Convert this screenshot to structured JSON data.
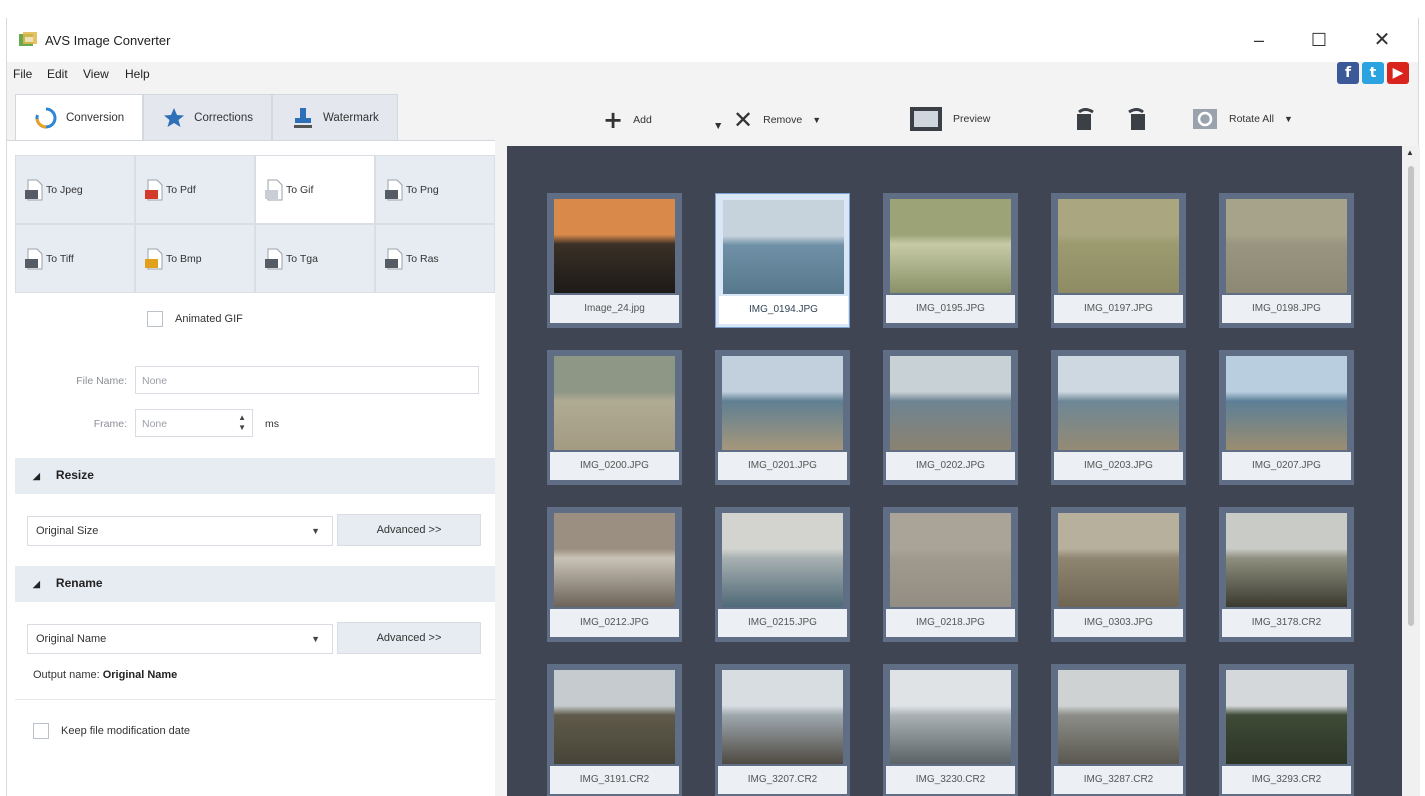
{
  "window": {
    "title": "AVS Image Converter"
  },
  "menu": [
    "File",
    "Edit",
    "View",
    "Help"
  ],
  "social": [
    {
      "icon": "facebook-icon",
      "glyph": "f",
      "color": "#3b5998"
    },
    {
      "icon": "twitter-icon",
      "glyph": "t",
      "color": "#2aa3e0"
    },
    {
      "icon": "youtube-icon",
      "glyph": "▶",
      "color": "#d9231d"
    }
  ],
  "tabs": [
    {
      "label": "Conversion",
      "icon": "conversion-icon",
      "active": true
    },
    {
      "label": "Corrections",
      "icon": "star-icon",
      "active": false
    },
    {
      "label": "Watermark",
      "icon": "stamp-icon",
      "active": false
    }
  ],
  "formats": [
    {
      "label": "To Jpeg",
      "icon": "jpeg-icon",
      "color": "#555c66"
    },
    {
      "label": "To Pdf",
      "icon": "pdf-icon",
      "color": "#d33a2b"
    },
    {
      "label": "To Gif",
      "icon": "gif-icon",
      "color": "#c9ced6",
      "active": true
    },
    {
      "label": "To Png",
      "icon": "png-icon",
      "color": "#555c66"
    },
    {
      "label": "To Tiff",
      "icon": "tiff-icon",
      "color": "#555c66"
    },
    {
      "label": "To Bmp",
      "icon": "bmp-icon",
      "color": "#e0a21c"
    },
    {
      "label": "To Tga",
      "icon": "tga-icon",
      "color": "#555c66"
    },
    {
      "label": "To Ras",
      "icon": "ras-icon",
      "color": "#555c66"
    }
  ],
  "options": {
    "animated_gif": "Animated GIF",
    "file_name_label": "File Name:",
    "file_name_value": "None",
    "frame_label": "Frame:",
    "frame_value": "None",
    "frame_unit": "ms"
  },
  "resize": {
    "title": "Resize",
    "value": "Original Size",
    "advanced": "Advanced >>"
  },
  "rename": {
    "title": "Rename",
    "value": "Original Name",
    "advanced": "Advanced >>",
    "output_label": "Output name:",
    "output_value": "Original Name"
  },
  "keep_date": "Keep file modification date",
  "toolbar": {
    "add": "Add",
    "remove": "Remove",
    "preview": "Preview",
    "rotate_all": "Rotate All"
  },
  "images": [
    {
      "name": "Image_24.jpg",
      "selected": false,
      "colors": [
        "#d98a4a",
        "#3a3026",
        "#1d1a18"
      ]
    },
    {
      "name": "IMG_0194.JPG",
      "selected": true,
      "colors": [
        "#c7d3dc",
        "#6f90a6",
        "#57788c"
      ]
    },
    {
      "name": "IMG_0195.JPG",
      "selected": false,
      "colors": [
        "#9ba377",
        "#c6cba5",
        "#8a9168"
      ]
    },
    {
      "name": "IMG_0197.JPG",
      "selected": false,
      "colors": [
        "#a9a680",
        "#9c9a6f",
        "#8f8c65"
      ]
    },
    {
      "name": "IMG_0198.JPG",
      "selected": false,
      "colors": [
        "#a6a38a",
        "#999580",
        "#8c8874"
      ]
    },
    {
      "name": "IMG_0200.JPG",
      "selected": false,
      "colors": [
        "#8e9685",
        "#b0ab93",
        "#a39a82"
      ]
    },
    {
      "name": "IMG_0201.JPG",
      "selected": false,
      "colors": [
        "#c2d0dd",
        "#5f7f93",
        "#a5977b"
      ]
    },
    {
      "name": "IMG_0202.JPG",
      "selected": false,
      "colors": [
        "#c8d1d6",
        "#6e8492",
        "#8b8271"
      ]
    },
    {
      "name": "IMG_0203.JPG",
      "selected": false,
      "colors": [
        "#cdd8e1",
        "#6d8796",
        "#958a74"
      ]
    },
    {
      "name": "IMG_0207.JPG",
      "selected": false,
      "colors": [
        "#b9cfe0",
        "#5c7f97",
        "#9b8d70"
      ]
    },
    {
      "name": "IMG_0212.JPG",
      "selected": false,
      "colors": [
        "#9a8f80",
        "#c9c2b6",
        "#6d6459"
      ]
    },
    {
      "name": "IMG_0215.JPG",
      "selected": false,
      "colors": [
        "#d3d4d0",
        "#a8b0b1",
        "#4f6a78"
      ]
    },
    {
      "name": "IMG_0218.JPG",
      "selected": false,
      "colors": [
        "#aaa498",
        "#9f9a8e",
        "#938e83"
      ]
    },
    {
      "name": "IMG_0303.JPG",
      "selected": false,
      "colors": [
        "#b7b09d",
        "#8f8671",
        "#6e6553"
      ]
    },
    {
      "name": "IMG_3178.CR2",
      "selected": false,
      "colors": [
        "#c8cbc6",
        "#8f8f7f",
        "#3a3a30"
      ]
    },
    {
      "name": "IMG_3191.CR2",
      "selected": false,
      "colors": [
        "#c5cbce",
        "#5f5a4a",
        "#474538"
      ]
    },
    {
      "name": "IMG_3207.CR2",
      "selected": false,
      "colors": [
        "#d8dde2",
        "#9ea8ae",
        "#4f4a42"
      ]
    },
    {
      "name": "IMG_3230.CR2",
      "selected": false,
      "colors": [
        "#e0e3e6",
        "#aab1b5",
        "#5a6266"
      ]
    },
    {
      "name": "IMG_3287.CR2",
      "selected": false,
      "colors": [
        "#cfd2d3",
        "#8c8d88",
        "#5a584f"
      ]
    },
    {
      "name": "IMG_3293.CR2",
      "selected": false,
      "colors": [
        "#d5d8da",
        "#3e4a36",
        "#2d3527"
      ]
    }
  ]
}
